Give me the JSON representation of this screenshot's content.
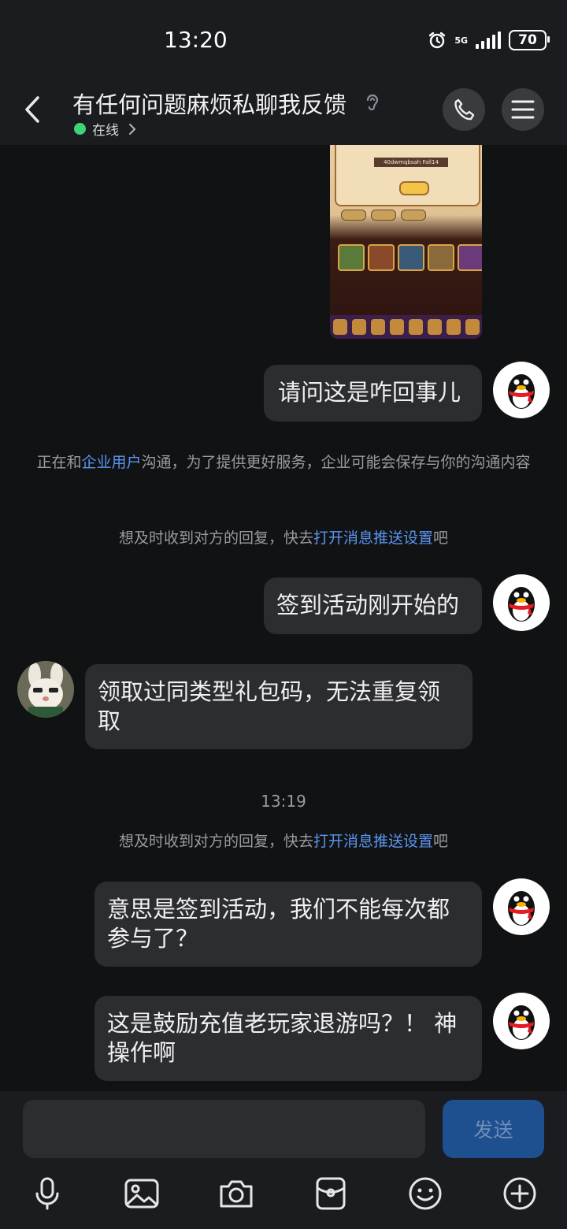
{
  "status_bar": {
    "time": "13:20",
    "network": "5G",
    "battery": "70"
  },
  "header": {
    "title": "有任何问题麻烦私聊我反馈",
    "presence": "在线"
  },
  "screenshot_preview": {
    "code_text": "40dwmqbsah Fall14"
  },
  "messages": [
    {
      "side": "right",
      "text": "请问这是咋回事儿"
    },
    {
      "side": "right",
      "text": "签到活动刚开始的"
    },
    {
      "side": "left",
      "text": "领取过同类型礼包码，无法重复领取"
    },
    {
      "side": "right",
      "text": "意思是签到活动，我们不能每次都参与了？"
    },
    {
      "side": "right",
      "text": "这是鼓励充值老玩家退游吗？！ 神操作啊"
    }
  ],
  "notices": {
    "enterprise": {
      "prefix": "正在和",
      "link": "企业用户",
      "suffix": "沟通，为了提供更好服务，企业可能会保存与你的沟通内容"
    },
    "push_1": {
      "prefix": "想及时收到对方的回复，快去",
      "link": "打开消息推送设置",
      "suffix": "吧"
    },
    "push_2": {
      "prefix": "想及时收到对方的回复，快去",
      "link": "打开消息推送设置",
      "suffix": "吧"
    }
  },
  "timestamp": "13:19",
  "composer": {
    "send_label": "发送",
    "input_value": ""
  },
  "toolbar": [
    "microphone-icon",
    "image-icon",
    "camera-icon",
    "red-packet-icon",
    "emoji-icon",
    "plus-icon"
  ],
  "colors": {
    "background": "#111214",
    "bubble": "#2c2d31",
    "link": "#5b95f0",
    "online": "#3fd277",
    "send_button": "#1e4f8e"
  }
}
